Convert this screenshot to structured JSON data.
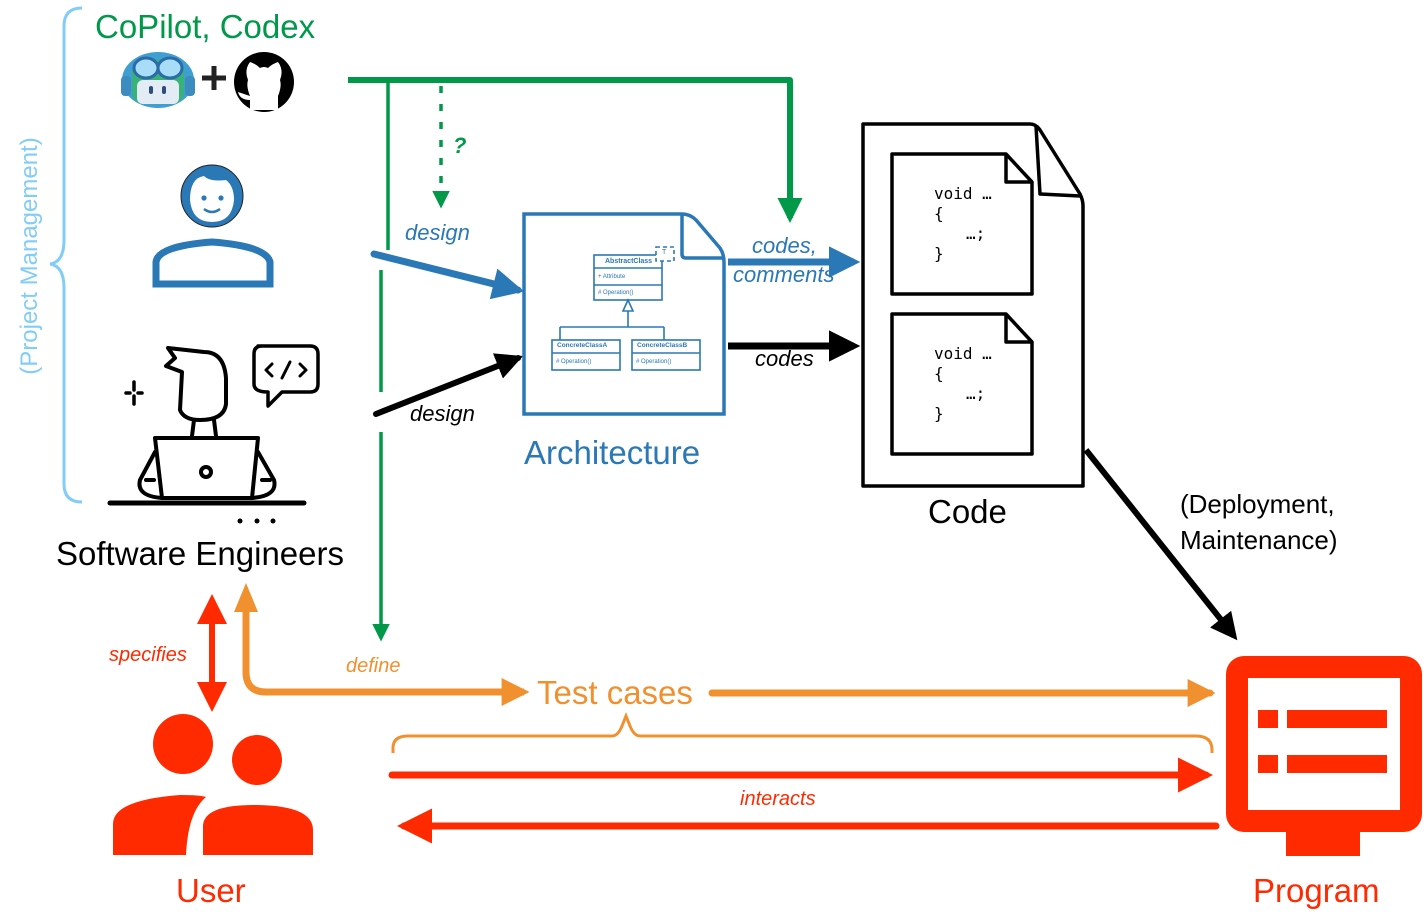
{
  "colors": {
    "green": "#00994a",
    "blue": "#2a78b6",
    "orange": "#f0902e",
    "red": "#ff2a00",
    "black": "#000000",
    "light_blue": "#82cdf7"
  },
  "actors": {
    "ai_tools": {
      "label": "CoPilot, Codex",
      "icons": [
        "copilot-icon",
        "plus-icon",
        "github-icon"
      ]
    },
    "project_management": {
      "label": "(Project Management)"
    },
    "software_engineers": {
      "label": "Software Engineers",
      "ellipsis": "..."
    },
    "user": {
      "label": "User"
    },
    "program": {
      "label": "Program"
    }
  },
  "artifacts": {
    "architecture": {
      "label": "Architecture",
      "uml": {
        "template_param": "T",
        "abstract_class": {
          "name": "AbstractClass",
          "attribute": "+ Attribute",
          "operation": "# Operation()"
        },
        "concrete_a": {
          "name": "ConcreteClassA",
          "operation": "# Operation()"
        },
        "concrete_b": {
          "name": "ConcreteClassB",
          "operation": "# Operation()"
        }
      }
    },
    "code": {
      "label": "Code",
      "snippets": [
        {
          "line1": "void …",
          "line2": "{",
          "line3": "…;",
          "line4": "}"
        },
        {
          "line1": "void …",
          "line2": "{",
          "line3": "…;",
          "line4": "}"
        }
      ]
    },
    "test_cases": {
      "label": "Test cases"
    }
  },
  "edges": {
    "ai_question": "?",
    "human_design": "design",
    "engineer_design": "design",
    "codes_comments_1": "codes,",
    "codes_comments_2": "comments",
    "codes": "codes",
    "deployment_1": "(Deployment,",
    "deployment_2": "Maintenance)",
    "specifies": "specifies",
    "define": "define",
    "interacts": "interacts"
  }
}
